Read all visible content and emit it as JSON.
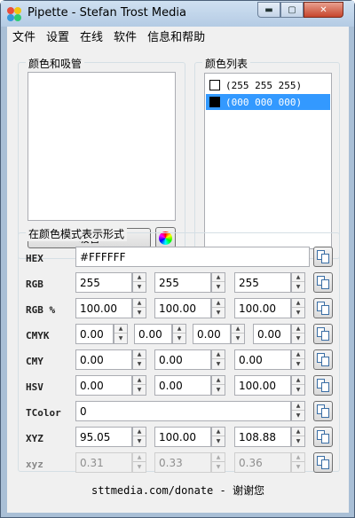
{
  "window": {
    "title": "Pipette - Stefan Trost Media"
  },
  "menu": [
    "文件",
    "设置",
    "在线",
    "软件",
    "信息和帮助"
  ],
  "picker_group": {
    "title": "颜色和吸管",
    "pick_label": "吸管"
  },
  "colorlist_group": {
    "title": "颜色列表",
    "items": [
      {
        "label": "(255 255 255)",
        "swatch": "#ffffff",
        "selected": false
      },
      {
        "label": "(000 000 000)",
        "swatch": "#000000",
        "selected": true
      }
    ]
  },
  "formats_group": {
    "title": "在颜色模式表示形式",
    "rows": {
      "hex": {
        "label": "HEX",
        "value": "#FFFFFF"
      },
      "rgb": {
        "label": "RGB",
        "values": [
          "255",
          "255",
          "255"
        ]
      },
      "rgb_pct": {
        "label": "RGB %",
        "values": [
          "100.00",
          "100.00",
          "100.00"
        ]
      },
      "cmyk": {
        "label": "CMYK",
        "values": [
          "0.00",
          "0.00",
          "0.00",
          "0.00"
        ]
      },
      "cmy": {
        "label": "CMY",
        "values": [
          "0.00",
          "0.00",
          "0.00"
        ]
      },
      "hsv": {
        "label": "HSV",
        "values": [
          "0.00",
          "0.00",
          "100.00"
        ]
      },
      "tcolor": {
        "label": "TColor",
        "value": "0"
      },
      "xyz": {
        "label": "XYZ",
        "values": [
          "95.05",
          "100.00",
          "108.88"
        ]
      },
      "xyz_lower": {
        "label": "xyz",
        "values": [
          "0.31",
          "0.33",
          "0.36"
        ]
      }
    }
  },
  "footer": "sttmedia.com/donate - 谢谢您"
}
